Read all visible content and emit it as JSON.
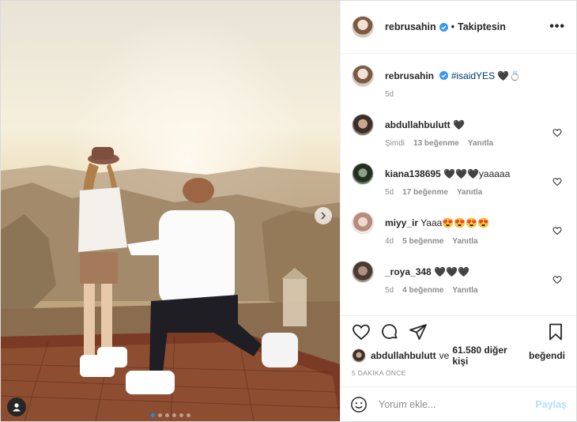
{
  "header": {
    "username": "rebrusahin",
    "separator": "•",
    "follow_status": "Takiptesin",
    "more_label": "•••"
  },
  "caption": {
    "username": "rebrusahin",
    "hashtag": "#isaidYES",
    "emoji": "🖤💍",
    "age": "5d"
  },
  "comments": [
    {
      "username": "abdullahbulutt",
      "text": "🖤",
      "age": "Şimdi",
      "likes": "13 beğenme",
      "reply": "Yanıtla"
    },
    {
      "username": "kiana138695",
      "text": "🖤🖤🖤yaaaaa",
      "age": "5d",
      "likes": "17 beğenme",
      "reply": "Yanıtla"
    },
    {
      "username": "miyy_ir",
      "text": "Yaaa😍😍😍😍",
      "age": "4d",
      "likes": "5 beğenme",
      "reply": "Yanıtla"
    },
    {
      "username": "_roya_348",
      "text": "🖤🖤🖤",
      "age": "5d",
      "likes": "4 beğenme",
      "reply": "Yanıtla"
    }
  ],
  "likes_line": {
    "user": "abdullahbulutt",
    "connector": "ve",
    "others": "61.580 diğer kişi",
    "suffix": "beğendi"
  },
  "timestamp": "5 DAKİKA ÖNCE",
  "add_comment": {
    "placeholder": "Yorum ekle...",
    "post_label": "Paylaş"
  },
  "carousel": {
    "total": 6,
    "current": 1
  },
  "colors": {
    "accent": "#0095f6",
    "verified": "#3897f0",
    "hashtag": "#00376b"
  }
}
